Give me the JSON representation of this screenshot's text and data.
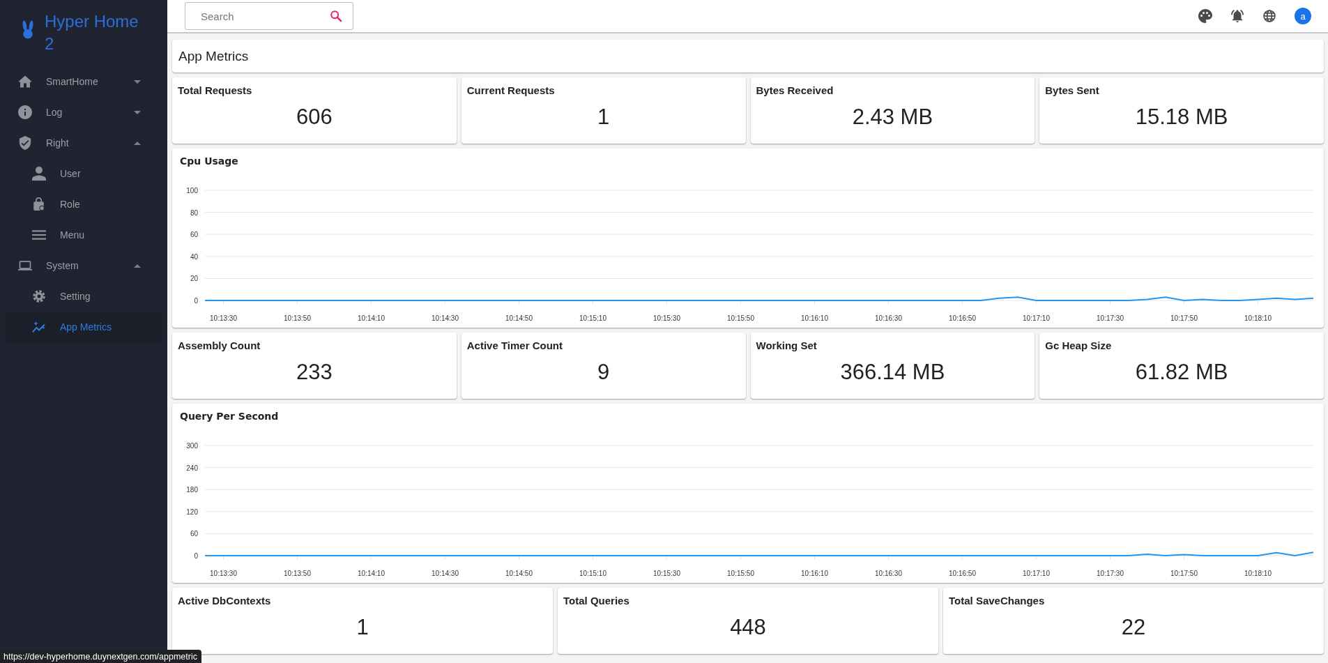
{
  "sidebar": {
    "brand": "Hyper Home 2",
    "items": [
      {
        "label": "SmartHome",
        "expanded": false
      },
      {
        "label": "Log",
        "expanded": false
      },
      {
        "label": "Right",
        "expanded": true,
        "children": [
          {
            "label": "User",
            "selected": false
          },
          {
            "label": "Role",
            "selected": false
          },
          {
            "label": "Menu",
            "selected": false
          }
        ]
      },
      {
        "label": "System",
        "expanded": true,
        "children": [
          {
            "label": "Setting",
            "selected": false
          },
          {
            "label": "App Metrics",
            "selected": true
          }
        ]
      }
    ]
  },
  "topbar": {
    "search": {
      "placeholder": "Search"
    },
    "avatar": "a"
  },
  "page_title": "App Metrics",
  "panels": [
    {
      "kind": "stats",
      "items": [
        {
          "label": "Total Requests",
          "value": "606"
        },
        {
          "label": "Current Requests",
          "value": "1"
        },
        {
          "label": "Bytes Received",
          "value": "2.43 MB"
        },
        {
          "label": "Bytes Sent",
          "value": "15.18 MB"
        }
      ]
    },
    {
      "kind": "chart",
      "chart_data": {
        "type": "line",
        "title": "Cpu Usage",
        "categories": [
          null,
          "10:13:30",
          null,
          null,
          null,
          "10:13:50",
          null,
          null,
          null,
          "10:14:10",
          null,
          null,
          null,
          "10:14:30",
          null,
          null,
          null,
          "10:14:50",
          null,
          null,
          null,
          "10:15:10",
          null,
          null,
          null,
          "10:15:30",
          null,
          null,
          null,
          "10:15:50",
          null,
          null,
          null,
          "10:16:10",
          null,
          null,
          null,
          "10:16:30",
          null,
          null,
          null,
          "10:16:50",
          null,
          null,
          null,
          "10:17:10",
          null,
          null,
          null,
          "10:17:30",
          null,
          null,
          null,
          "10:17:50",
          null,
          null,
          null,
          "10:18:10",
          null,
          null,
          null
        ],
        "series": [
          {
            "color": "#2196f3",
            "values": [
              0,
              0,
              0,
              0,
              0,
              0,
              0,
              0,
              0,
              0,
              0,
              0,
              0,
              0,
              0,
              0,
              0,
              0,
              0,
              0,
              0,
              0,
              0,
              0,
              0,
              0,
              0,
              0,
              0,
              0,
              0,
              0,
              0,
              0,
              0,
              0,
              0,
              0,
              0,
              0,
              0,
              0,
              0,
              2,
              3,
              0,
              0,
              0,
              0,
              0,
              0,
              1,
              3,
              0,
              1,
              0,
              0,
              1,
              2,
              1,
              2
            ]
          }
        ],
        "ylim": [
          0,
          100
        ],
        "yticks": [
          0,
          20,
          40,
          60,
          80,
          100
        ],
        "grid": true
      }
    },
    {
      "kind": "stats",
      "items": [
        {
          "label": "Assembly Count",
          "value": "233"
        },
        {
          "label": "Active Timer Count",
          "value": "9"
        },
        {
          "label": "Working Set",
          "value": "366.14 MB"
        },
        {
          "label": "Gc Heap Size",
          "value": "61.82 MB"
        }
      ]
    },
    {
      "kind": "chart",
      "chart_data": {
        "type": "line",
        "title": "Query Per Second",
        "categories": [
          null,
          "10:13:30",
          null,
          null,
          null,
          "10:13:50",
          null,
          null,
          null,
          "10:14:10",
          null,
          null,
          null,
          "10:14:30",
          null,
          null,
          null,
          "10:14:50",
          null,
          null,
          null,
          "10:15:10",
          null,
          null,
          null,
          "10:15:30",
          null,
          null,
          null,
          "10:15:50",
          null,
          null,
          null,
          "10:16:10",
          null,
          null,
          null,
          "10:16:30",
          null,
          null,
          null,
          "10:16:50",
          null,
          null,
          null,
          "10:17:10",
          null,
          null,
          null,
          "10:17:30",
          null,
          null,
          null,
          "10:17:50",
          null,
          null,
          null,
          "10:18:10",
          null,
          null,
          null
        ],
        "series": [
          {
            "color": "#2196f3",
            "values": [
              0,
              0,
              0,
              0,
              0,
              0,
              0,
              0,
              0,
              0,
              0,
              0,
              0,
              0,
              0,
              0,
              0,
              0,
              0,
              0,
              0,
              0,
              0,
              0,
              0,
              0,
              0,
              0,
              0,
              0,
              0,
              0,
              0,
              0,
              0,
              0,
              0,
              0,
              0,
              0,
              0,
              0,
              0,
              0,
              0,
              0,
              0,
              0,
              0,
              0,
              0,
              4,
              0,
              3,
              0,
              0,
              0,
              0,
              8,
              0,
              9
            ]
          }
        ],
        "ylim": [
          0,
          300
        ],
        "yticks": [
          0,
          60,
          120,
          180,
          240,
          300
        ],
        "grid": true
      }
    },
    {
      "kind": "stats",
      "items": [
        {
          "label": "Active DbContexts",
          "value": "1"
        },
        {
          "label": "Total Queries",
          "value": "448"
        },
        {
          "label": "Total SaveChanges",
          "value": "22"
        }
      ]
    }
  ],
  "status_url": "https://dev-hyperhome.duynextgen.com/appmetric"
}
